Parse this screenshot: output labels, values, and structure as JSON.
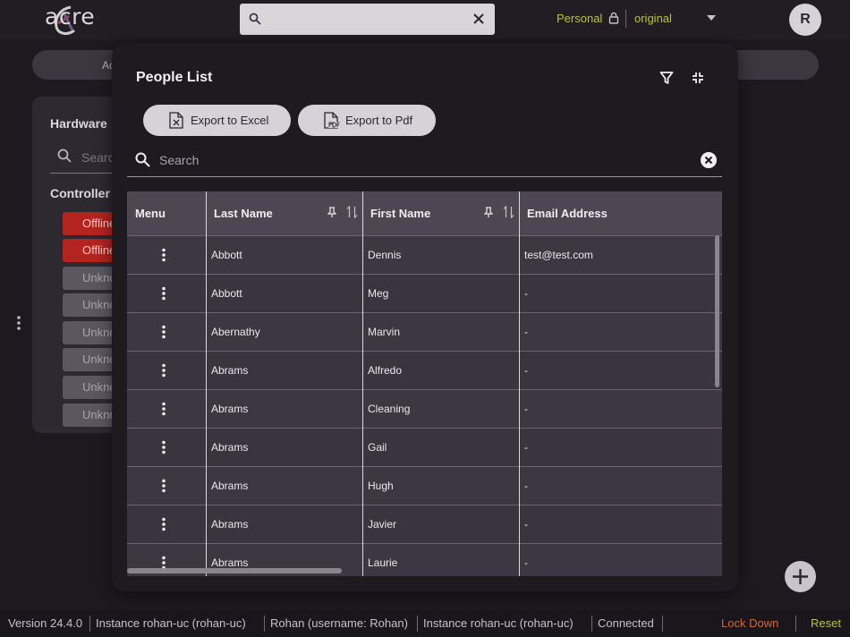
{
  "topbar": {
    "logo_text": "acre",
    "search": {
      "value": ""
    },
    "workspace": "Personal",
    "config": "original",
    "avatar_initial": "R"
  },
  "background": {
    "pill_text": "Ac",
    "hardware_title": "Hardware",
    "search_placeholder": "Search",
    "controllers_label": "Controller",
    "chips": [
      {
        "label": "Offline",
        "status": "offline"
      },
      {
        "label": "Offline",
        "status": "offline"
      },
      {
        "label": "Unknown",
        "status": "unknown"
      },
      {
        "label": "Unknown",
        "status": "unknown"
      },
      {
        "label": "Unknown",
        "status": "unknown"
      },
      {
        "label": "Unknown",
        "status": "unknown"
      },
      {
        "label": "Unknown",
        "status": "unknown"
      },
      {
        "label": "Unknown",
        "status": "unknown"
      }
    ]
  },
  "modal": {
    "title": "People List",
    "export_excel": "Export to Excel",
    "export_pdf": "Export to Pdf",
    "search_placeholder": "Search",
    "columns": [
      "Menu",
      "Last Name",
      "First Name",
      "Email Address"
    ],
    "rows": [
      {
        "last": "Abbott",
        "first": "Dennis",
        "email": "test@test.com"
      },
      {
        "last": "Abbott",
        "first": "Meg",
        "email": "-"
      },
      {
        "last": "Abernathy",
        "first": "Marvin",
        "email": "-"
      },
      {
        "last": "Abrams",
        "first": "Alfredo",
        "email": "-"
      },
      {
        "last": "Abrams",
        "first": "Cleaning",
        "email": "-"
      },
      {
        "last": "Abrams",
        "first": "Gail",
        "email": "-"
      },
      {
        "last": "Abrams",
        "first": "Hugh",
        "email": "-"
      },
      {
        "last": "Abrams",
        "first": "Javier",
        "email": "-"
      },
      {
        "last": "Abrams",
        "first": "Laurie",
        "email": "-"
      }
    ]
  },
  "footer": {
    "version": "Version 24.4.0",
    "instance1": "Instance rohan-uc (rohan-uc)",
    "user": "Rohan (username: Rohan)",
    "instance2": "Instance rohan-uc (rohan-uc)",
    "status": "Connected",
    "lock_down": "Lock Down",
    "reset": "Reset"
  },
  "colors": {
    "accent": "#b7c636",
    "offline": "#b3241f",
    "lockdown": "#c96b3f"
  }
}
